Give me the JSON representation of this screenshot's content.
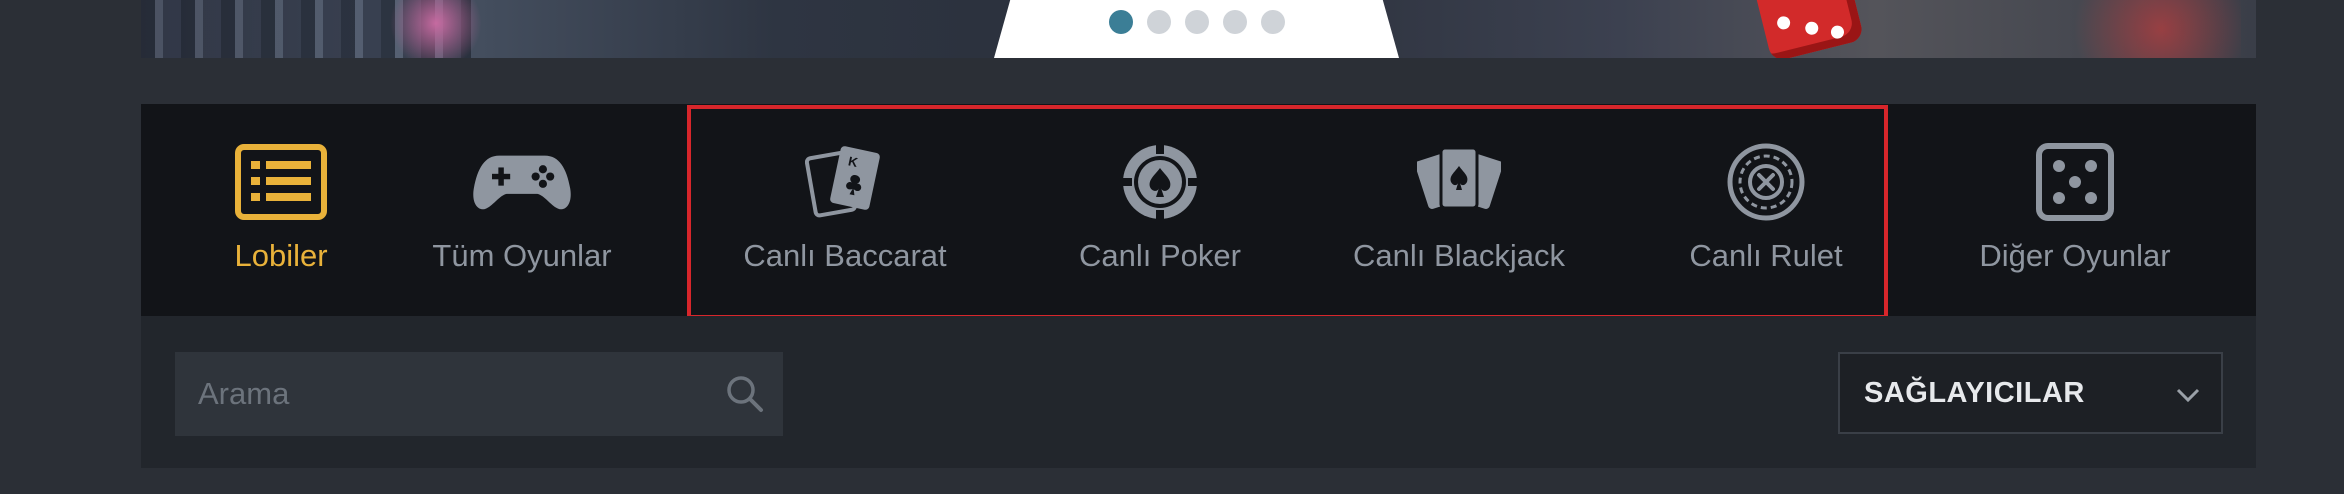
{
  "banner": {
    "slides": 5,
    "active_slide": 1
  },
  "categories": [
    {
      "label": "Lobiler",
      "icon": "list-icon",
      "active": true
    },
    {
      "label": "Tüm Oyunlar",
      "icon": "gamepad-icon",
      "active": false
    },
    {
      "label": "Canlı Baccarat",
      "icon": "playing-cards-icon",
      "active": false
    },
    {
      "label": "Canlı Poker",
      "icon": "poker-chip-icon",
      "active": false
    },
    {
      "label": "Canlı Blackjack",
      "icon": "blackjack-cards-icon",
      "active": false
    },
    {
      "label": "Canlı Rulet",
      "icon": "roulette-icon",
      "active": false
    },
    {
      "label": "Diğer Oyunlar",
      "icon": "dice-icon",
      "active": false
    }
  ],
  "search": {
    "placeholder": "Arama"
  },
  "providers": {
    "label": "SAĞLAYICILAR"
  },
  "colors": {
    "accent": "#e9b23a",
    "highlight_border": "#d7262b",
    "active_dot": "#3b7e96"
  }
}
